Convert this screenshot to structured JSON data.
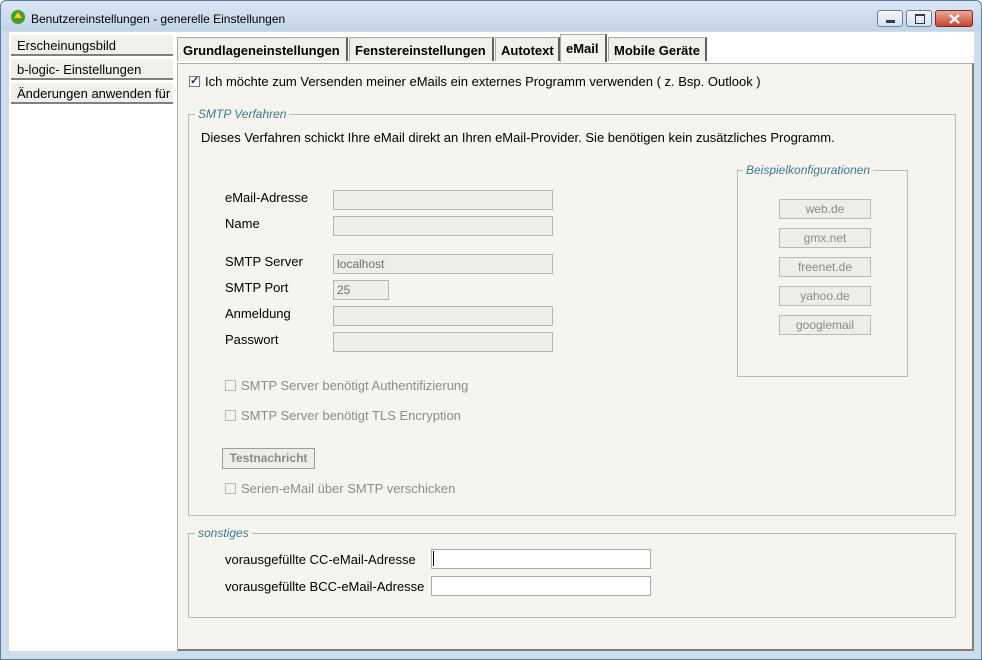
{
  "window": {
    "title": "Benutzereinstellungen - generelle Einstellungen",
    "icons": [
      "app-icon",
      "minimize-icon",
      "maximize-icon",
      "close-icon"
    ]
  },
  "sidebar": {
    "items": [
      {
        "label": "Erscheinungsbild"
      },
      {
        "label": "b-logic- Einstellungen"
      },
      {
        "label": "Änderungen anwenden für"
      }
    ]
  },
  "tabs": [
    {
      "label": "Grundlageneinstellungen",
      "active": false
    },
    {
      "label": "Fenstereinstellungen",
      "active": false
    },
    {
      "label": "Autotext",
      "active": false
    },
    {
      "label": "eMail",
      "active": true
    },
    {
      "label": "Mobile Geräte",
      "active": false
    }
  ],
  "email": {
    "external_program": {
      "label": "Ich möchte zum Versenden meiner eMails ein externes Programm verwenden ( z. Bsp. Outlook )",
      "checked": true
    },
    "smtp": {
      "legend": "SMTP Verfahren",
      "description": "Dieses Verfahren schickt Ihre eMail direkt an Ihren eMail-Provider. Sie benötigen kein zusätzliches Programm.",
      "fields": {
        "email_label": "eMail-Adresse",
        "email_value": "",
        "name_label": "Name",
        "name_value": "",
        "server_label": "SMTP Server",
        "server_value": "localhost",
        "port_label": "SMTP Port",
        "port_value": "25",
        "login_label": "Anmeldung",
        "login_value": "",
        "password_label": "Passwort",
        "password_value": ""
      },
      "auth_label": "SMTP Server benötigt Authentifizierung",
      "tls_label": "SMTP Server benötigt TLS Encryption",
      "test_button": "Testnachricht",
      "serial_label": "Serien-eMail über SMTP verschicken",
      "examples": {
        "legend": "Beispielkonfigurationen",
        "buttons": [
          "web.de",
          "gmx.net",
          "freenet.de",
          "yahoo.de",
          "googlemail"
        ]
      }
    },
    "other": {
      "legend": "sonstiges",
      "cc_label": "vorausgefüllte CC-eMail-Adresse",
      "cc_value": "",
      "bcc_label": "vorausgefüllte BCC-eMail-Adresse",
      "bcc_value": ""
    }
  },
  "colors": {
    "legend": "#3d7a8d",
    "panel": "#f5f4ee",
    "titlebar": "#c3d4e8",
    "close": "#c8442d"
  }
}
